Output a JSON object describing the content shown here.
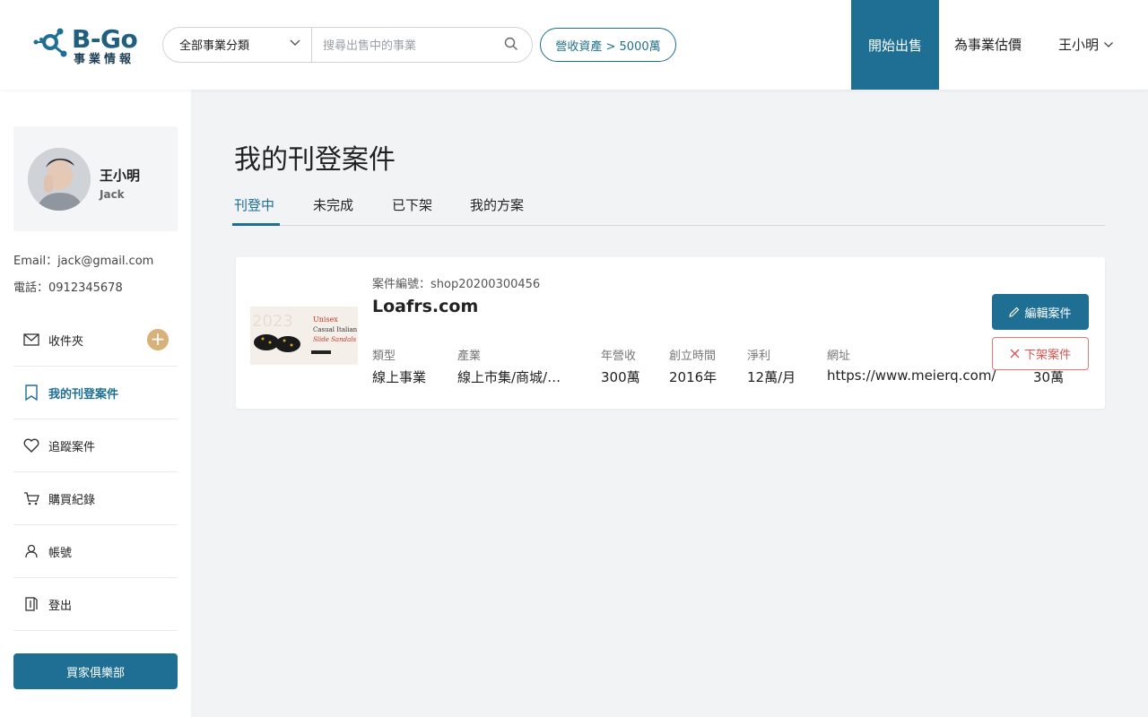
{
  "header": {
    "logo_text": "B-Go",
    "logo_sub": "事業情報",
    "category_select": "全部事業分類",
    "search_placeholder": "搜尋出售中的事業",
    "filter_chip": "營收資產 > 5000萬",
    "sell_button": "開始出售",
    "valuate_link": "為事業估價",
    "user_menu": "王小明"
  },
  "sidebar": {
    "name": "王小明",
    "name_en": "Jack",
    "email": "Email：jack@gmail.com",
    "phone": "電話：0912345678",
    "items": [
      {
        "label": "收件夾",
        "icon": "mail-icon"
      },
      {
        "label": "我的刊登案件",
        "icon": "document-icon",
        "active": true
      },
      {
        "label": "追蹤案件",
        "icon": "heart-icon"
      },
      {
        "label": "購買紀錄",
        "icon": "cart-icon"
      },
      {
        "label": "帳號",
        "icon": "user-icon"
      },
      {
        "label": "登出",
        "icon": "logout-icon"
      }
    ],
    "add_symbol": "+",
    "club_button": "買家俱樂部"
  },
  "main": {
    "title": "我的刊登案件",
    "tabs": [
      "刊登中",
      "未完成",
      "已下架",
      "我的方案"
    ],
    "listing": {
      "case_number": "案件編號：shop20200300456",
      "title": "Loafrs.com",
      "thumb_text": [
        "Unisex",
        "Casual Italian",
        "Slide Sandals"
      ],
      "fields": [
        {
          "label": "類型",
          "value": "線上事業"
        },
        {
          "label": "產業",
          "value": "線上市集/商城/平台"
        },
        {
          "label": "年營收",
          "value": "300萬"
        },
        {
          "label": "創立時間",
          "value": "2016年"
        },
        {
          "label": "淨利",
          "value": "12萬/月"
        },
        {
          "label": "網址",
          "value": "https://www.meierq.com/"
        },
        {
          "label": "",
          "value": "30萬"
        }
      ],
      "edit_button": "編輯案件",
      "remove_button": "下架案件"
    }
  },
  "colors": {
    "primary": "#1f6f94",
    "accent_gold": "#d8b17a",
    "danger": "#d9534f"
  }
}
